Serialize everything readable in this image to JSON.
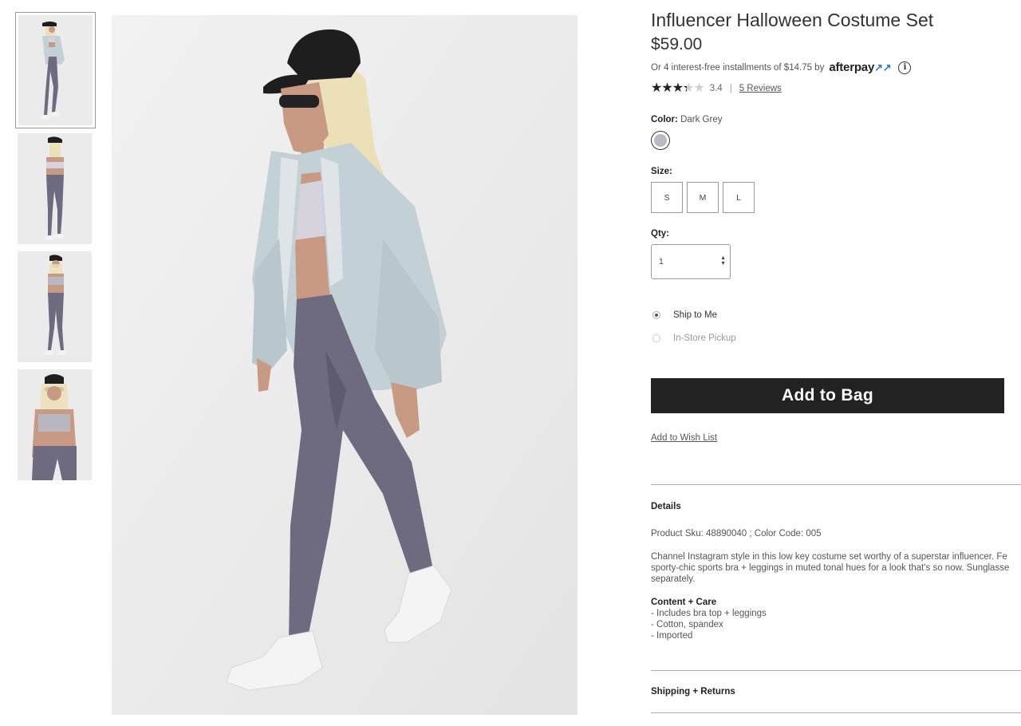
{
  "product": {
    "title": "Influencer Halloween Costume Set",
    "price": "$59.00",
    "afterpay_text": "Or 4 interest-free installments of $14.75 by",
    "afterpay_brand": "afterpay",
    "afterpay_mark": "↗↗",
    "info_glyph": "i",
    "rating": {
      "value": "3.4",
      "stars_filled_fraction": 0.68,
      "separator": "|",
      "reviews_label": "5 Reviews"
    },
    "color": {
      "label": "Color:",
      "value": "Dark Grey",
      "swatch_hex": "#b9b9c3"
    },
    "size": {
      "label": "Size:",
      "options": [
        "S",
        "M",
        "L"
      ]
    },
    "qty": {
      "label": "Qty:",
      "value": "1"
    },
    "fulfillment": [
      {
        "label": "Ship to Me",
        "selected": true
      },
      {
        "label": "In-Store Pickup",
        "selected": false
      }
    ],
    "add_to_bag": "Add to Bag",
    "wish_list": "Add to Wish List"
  },
  "details": {
    "heading": "Details",
    "sku_line": "Product Sku: 48890040 ; Color Code: 005",
    "description_lines": [
      "Channel Instagram style in this low key costume set worthy of a superstar influencer. Fe",
      "sporty-chic sports bra + leggings in muted tonal hues for a look that's so now. Sunglasse",
      "separately."
    ],
    "content_heading": "Content + Care",
    "content_items": [
      "- Includes bra top + leggings",
      "- Cotton, spandex",
      "- Imported"
    ]
  },
  "shipping": {
    "heading": "Shipping + Returns"
  },
  "gallery": {
    "thumbnail_count": 4,
    "active_index": 0,
    "colors": {
      "jacket": "#c3d0d6",
      "leggings": "#6e6b80",
      "hair": "#ece0b8",
      "cap": "#1e1e1e",
      "skin": "#c89a84",
      "shoe": "#f4f4f4",
      "bra": "#d6d3dc"
    }
  }
}
